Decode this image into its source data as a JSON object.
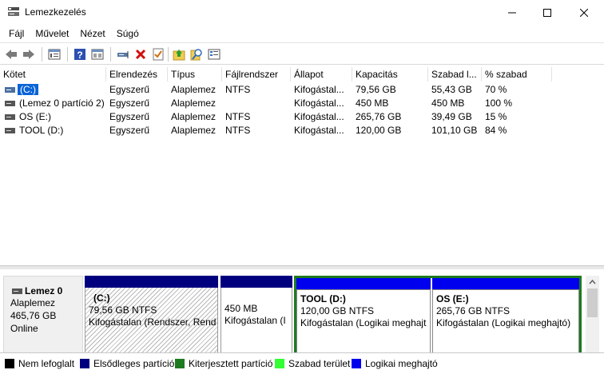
{
  "window": {
    "title": "Lemezkezelés"
  },
  "menu": [
    "Fájl",
    "Művelet",
    "Nézet",
    "Súgó"
  ],
  "columns": [
    "Kötet",
    "Elrendezés",
    "Típus",
    "Fájlrendszer",
    "Állapot",
    "Kapacitás",
    "Szabad l...",
    "% szabad"
  ],
  "volumes": [
    {
      "name": "(C:)",
      "layout": "Egyszerű",
      "type": "Alaplemez",
      "fs": "NTFS",
      "status": "Kifogástal...",
      "capacity": "79,56 GB",
      "free": "55,43 GB",
      "pct": "70 %",
      "selected": true
    },
    {
      "name": "(Lemez 0 partíció 2)",
      "layout": "Egyszerű",
      "type": "Alaplemez",
      "fs": "",
      "status": "Kifogástal...",
      "capacity": "450 MB",
      "free": "450 MB",
      "pct": "100 %",
      "selected": false
    },
    {
      "name": "OS (E:)",
      "layout": "Egyszerű",
      "type": "Alaplemez",
      "fs": "NTFS",
      "status": "Kifogástal...",
      "capacity": "265,76 GB",
      "free": "39,49 GB",
      "pct": "15 %",
      "selected": false
    },
    {
      "name": "TOOL (D:)",
      "layout": "Egyszerű",
      "type": "Alaplemez",
      "fs": "NTFS",
      "status": "Kifogástal...",
      "capacity": "120,00 GB",
      "free": "101,10 GB",
      "pct": "84 %",
      "selected": false
    }
  ],
  "disk": {
    "name": "Lemez 0",
    "type": "Alaplemez",
    "size": "465,76 GB",
    "state": "Online"
  },
  "partitions": [
    {
      "name": "(C:)",
      "size": "79,56 GB NTFS",
      "status": "Kifogástalan (Rendszer, Rend"
    },
    {
      "name": "",
      "size": "450 MB",
      "status": "Kifogástalan (I"
    },
    {
      "name": "TOOL  (D:)",
      "size": "120,00 GB NTFS",
      "status": "Kifogástalan (Logikai meghajt"
    },
    {
      "name": "OS  (E:)",
      "size": "265,76 GB NTFS",
      "status": "Kifogástalan (Logikai meghajtó)"
    }
  ],
  "legend": [
    {
      "label": "Nem lefoglalt",
      "color": "#000000"
    },
    {
      "label": "Elsődleges partíció",
      "color": "#00007f"
    },
    {
      "label": "Kiterjesztett partíció",
      "color": "#1e7a1e"
    },
    {
      "label": "Szabad terület",
      "color": "#33ff33"
    },
    {
      "label": "Logikai meghajtó",
      "color": "#0000ee"
    }
  ],
  "toolbar_icons": [
    "back-icon",
    "forward-icon",
    "properties-view-icon",
    "help-icon",
    "console-view-icon",
    "connect-drive-icon",
    "delete-icon",
    "checklist-icon",
    "folder-up-icon",
    "search-icon",
    "properties-icon"
  ]
}
